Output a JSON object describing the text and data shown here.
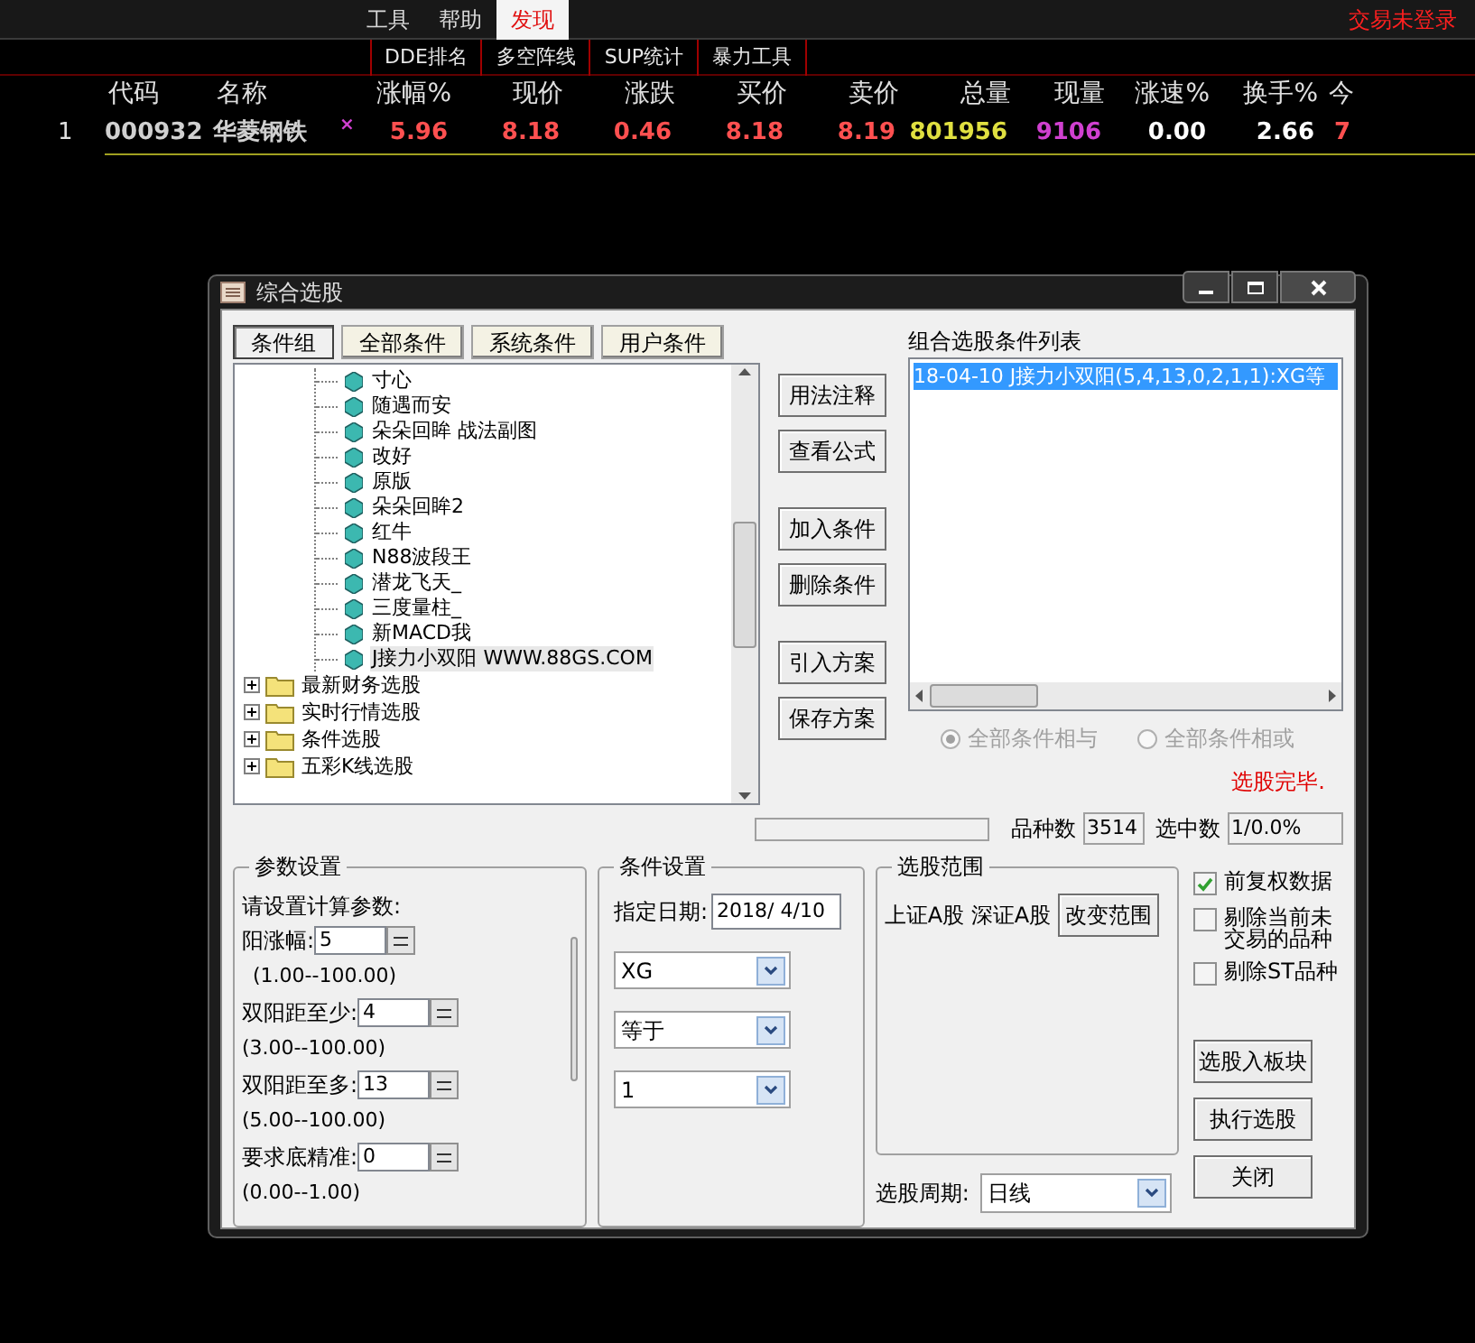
{
  "menu": {
    "items": [
      {
        "label": "工具",
        "selected": false
      },
      {
        "label": "帮助",
        "selected": false
      },
      {
        "label": "发现",
        "selected": true
      }
    ],
    "login_status": "交易未登录"
  },
  "subtabs": [
    {
      "label": "DDE排名"
    },
    {
      "label": "多空阵线"
    },
    {
      "label": "SUP统计"
    },
    {
      "label": "暴力工具"
    }
  ],
  "quote_table": {
    "columns": [
      {
        "label": "代码",
        "color": "#d0d0d0"
      },
      {
        "label": "名称",
        "color": "#d0d0d0"
      },
      {
        "label": "涨幅%",
        "color": "#ff5050"
      },
      {
        "label": "现价",
        "color": "#ff5050"
      },
      {
        "label": "涨跌",
        "color": "#ff5050"
      },
      {
        "label": "买价",
        "color": "#ff5050"
      },
      {
        "label": "卖价",
        "color": "#ff5050"
      },
      {
        "label": "总量",
        "color": "#e0e040"
      },
      {
        "label": "现量",
        "color": "#d040d0"
      },
      {
        "label": "涨速%",
        "color": "#ffffff"
      },
      {
        "label": "换手%",
        "color": "#ffffff"
      },
      {
        "label": "今",
        "color": "#ff5050"
      }
    ],
    "rows": [
      {
        "index": "1",
        "mark": "×",
        "cells": [
          "000932",
          "华菱钢铁",
          "5.96",
          "8.18",
          "0.46",
          "8.18",
          "8.19",
          "801956",
          "9106",
          "0.00",
          "2.66",
          "7"
        ]
      }
    ]
  },
  "dialog": {
    "title": "综合选股",
    "tabs": [
      {
        "label": "条件组",
        "selected": true
      },
      {
        "label": "全部条件",
        "selected": false
      },
      {
        "label": "系统条件",
        "selected": false
      },
      {
        "label": "用户条件",
        "selected": false
      }
    ],
    "tree": [
      {
        "kind": "group",
        "children": [
          {
            "kind": "formula",
            "label": "寸心",
            "selected": false
          },
          {
            "kind": "formula",
            "label": "随遇而安",
            "selected": false
          },
          {
            "kind": "formula",
            "label": "朵朵回眸 战法副图",
            "selected": false
          },
          {
            "kind": "formula",
            "label": "改好",
            "selected": false
          },
          {
            "kind": "formula",
            "label": "原版",
            "selected": false
          },
          {
            "kind": "formula",
            "label": "朵朵回眸2",
            "selected": false
          },
          {
            "kind": "formula",
            "label": "红牛",
            "selected": false
          },
          {
            "kind": "formula",
            "label": "N88波段王",
            "selected": false
          },
          {
            "kind": "formula",
            "label": "潜龙飞天_",
            "selected": false
          },
          {
            "kind": "formula",
            "label": "三度量柱_",
            "selected": false
          },
          {
            "kind": "formula",
            "label": "新MACD我",
            "selected": false
          },
          {
            "kind": "formula",
            "label": "J接力小双阳 WWW.88GS.COM",
            "selected": true
          }
        ]
      },
      {
        "kind": "folder",
        "label": "最新财务选股",
        "expanded": false
      },
      {
        "kind": "folder",
        "label": "实时行情选股",
        "expanded": false
      },
      {
        "kind": "folder",
        "label": "条件选股",
        "expanded": false
      },
      {
        "kind": "folder",
        "label": "五彩K线选股",
        "expanded": false
      }
    ],
    "action_buttons": [
      {
        "label": "用法注释"
      },
      {
        "label": "查看公式"
      },
      {
        "label": "加入条件"
      },
      {
        "label": "删除条件"
      },
      {
        "label": "引入方案"
      },
      {
        "label": "保存方案"
      }
    ],
    "condition_list": {
      "title": "组合选股条件列表",
      "items": [
        {
          "text": "18-04-10 J接力小双阳(5,4,13,0,2,1,1):XG等",
          "selected": true
        }
      ]
    },
    "logic": [
      {
        "label": "全部条件相与",
        "selected": true
      },
      {
        "label": "全部条件相或",
        "selected": false
      }
    ],
    "status": "选股完毕.",
    "progress": {
      "level": 0
    },
    "count_label": "品种数",
    "count_value": "3514",
    "hit_label": "选中数",
    "hit_value": "1/0.0%",
    "params": {
      "title": "参数设置",
      "intro": "请设置计算参数:",
      "items": [
        {
          "label": "阳涨幅:",
          "value": "5",
          "range": "(1.00--100.00)"
        },
        {
          "label": "双阳距至少:",
          "value": "4",
          "range": "(3.00--100.00)"
        },
        {
          "label": "双阳距至多:",
          "value": "13",
          "range": "(5.00--100.00)"
        },
        {
          "label": "要求底精准:",
          "value": "0",
          "range": "(0.00--1.00)"
        }
      ]
    },
    "condition_settings": {
      "title": "条件设置",
      "date_label": "指定日期:",
      "date_value": "2018/ 4/10",
      "selects": [
        "XG",
        "等于",
        "1"
      ]
    },
    "scope": {
      "title": "选股范围",
      "text": "上证A股 深证A股",
      "button": "改变范围"
    },
    "period": {
      "label": "选股周期:",
      "value": "日线"
    },
    "options": [
      {
        "label": "前复权数据",
        "checked": true
      },
      {
        "label": "剔除当前未交易的品种",
        "checked": false
      },
      {
        "label": "剔除ST品种",
        "checked": false
      }
    ],
    "buttons": [
      {
        "label": "选股入板块"
      },
      {
        "label": "执行选股"
      },
      {
        "label": "关闭"
      }
    ]
  }
}
